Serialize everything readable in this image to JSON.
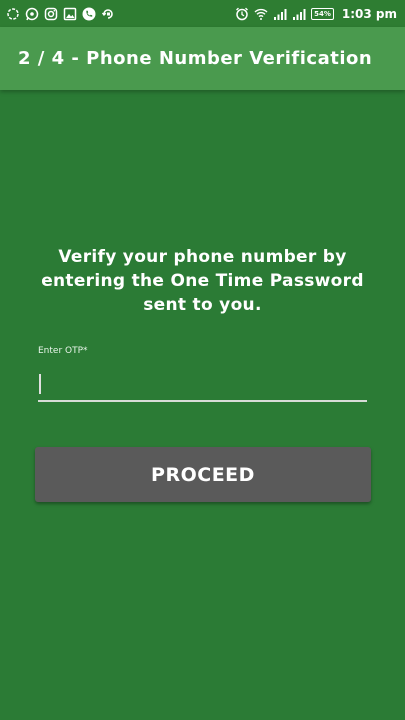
{
  "status_bar": {
    "left_icons": [
      "sync-circle-icon",
      "whatsapp-icon",
      "instagram-icon",
      "gallery-icon",
      "phone-icon",
      "app-notification-icon"
    ],
    "right_icons": [
      "alarm-icon",
      "wifi-icon",
      "signal-icon",
      "signal-icon"
    ],
    "battery": "54%",
    "time": "1:03 pm"
  },
  "app_bar": {
    "title": "2 / 4 - Phone Number Verification"
  },
  "main": {
    "instruction": "Verify your phone number by entering the One Time Password sent to you.",
    "otp_label": "Enter OTP*",
    "otp_value": "",
    "proceed_label": "PROCEED"
  },
  "colors": {
    "background": "#2b7b35",
    "app_bar": "#4a9a4e",
    "button": "#5a5a5a",
    "text": "#ffffff"
  }
}
